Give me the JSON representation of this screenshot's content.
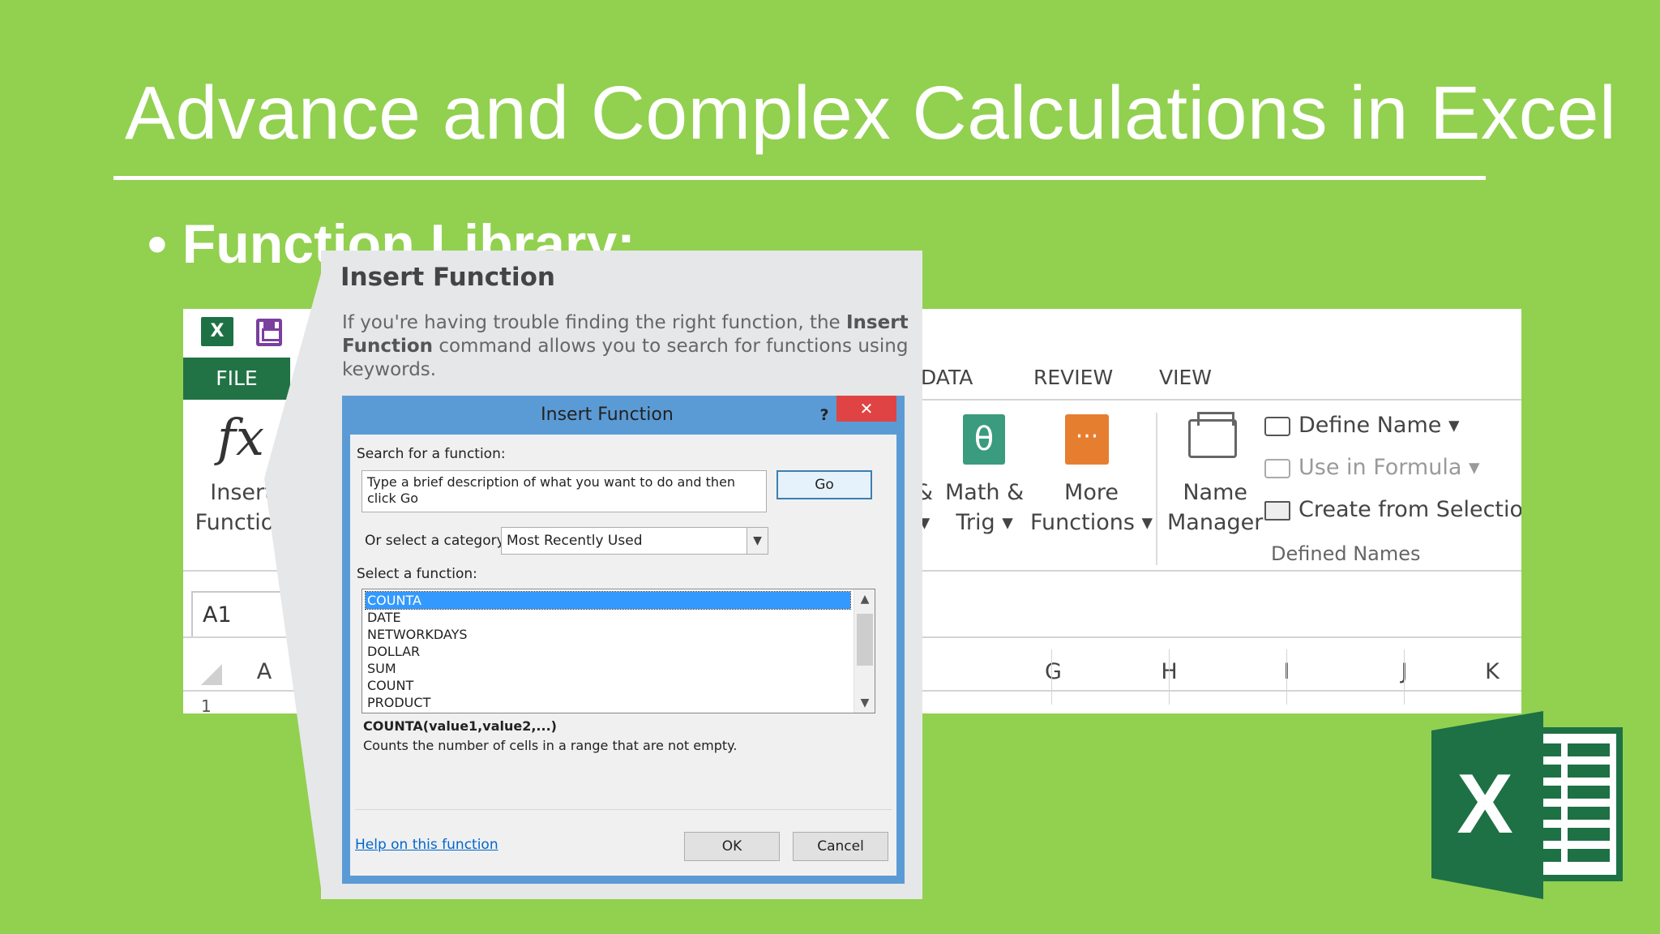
{
  "slide": {
    "title": "Advance and Complex Calculations in Excel",
    "bullet": "• Function Library:"
  },
  "ribbon": {
    "qat_logo": "X",
    "file_tab": "FILE",
    "tabs": [
      "DATA",
      "REVIEW",
      "VIEW"
    ],
    "insert_function": [
      "Insert",
      "Function"
    ],
    "math_trig": [
      "Math &",
      "Trig ▾"
    ],
    "more_functions": [
      "More",
      "Functions ▾"
    ],
    "name_manager": [
      "Name",
      "Manager"
    ],
    "left_fragment": [
      "&",
      "▾"
    ],
    "math_icon": "θ",
    "more_icon": "···",
    "define_name": "Define Name  ▾",
    "use_in_formula": "Use in Formula ▾",
    "create_from_selection": "Create from Selection",
    "defined_names_group": "Defined Names",
    "name_box": "A1",
    "columns": [
      "A",
      "G",
      "H",
      "I",
      "J",
      "K"
    ],
    "row_1": "1"
  },
  "callout": {
    "title": "Insert Function",
    "desc_part1": "If you're having trouble finding the right function, the ",
    "desc_bold": "Insert Function",
    "desc_part2": " command allows you to search for functions using keywords."
  },
  "dialog": {
    "title": "Insert Function",
    "help": "?",
    "close": "✕",
    "search_label": "Search for a function:",
    "search_value": "Type a brief description of what you want to do and then click Go",
    "go": "Go",
    "category_label": "Or select a category:",
    "category_value": "Most Recently Used",
    "select_label": "Select a function:",
    "functions": [
      "COUNTA",
      "DATE",
      "NETWORKDAYS",
      "DOLLAR",
      "SUM",
      "COUNT",
      "PRODUCT"
    ],
    "selected_function": "COUNTA",
    "syntax": "COUNTA(value1,value2,...)",
    "description": "Counts the number of cells in a range that are not empty.",
    "help_link": "Help on this function",
    "ok": "OK",
    "cancel": "Cancel"
  },
  "colors": {
    "background": "#92d050",
    "excel_green": "#217346",
    "dialog_border": "#5b9bd5",
    "close_red": "#e04343",
    "selection_blue": "#3399ff"
  }
}
